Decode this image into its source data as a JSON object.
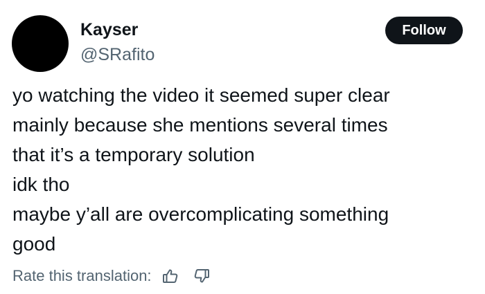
{
  "author": {
    "display_name": "Kayser",
    "handle": "@SRafito"
  },
  "follow_label": "Follow",
  "tweet": {
    "lines": [
      "yo watching the video it seemed super clear",
      "mainly because she mentions several times",
      "that it’s a temporary solution",
      "idk tho",
      "maybe y’all are overcomplicating something",
      "good"
    ]
  },
  "translation": {
    "rate_label": "Rate this translation:",
    "up_icon": "thumbs-up-icon",
    "down_icon": "thumbs-down-icon"
  },
  "colors": {
    "text_primary": "#0f1419",
    "text_secondary": "#536471",
    "button_bg": "#0f1419",
    "button_text": "#ffffff",
    "avatar": "#000000"
  }
}
